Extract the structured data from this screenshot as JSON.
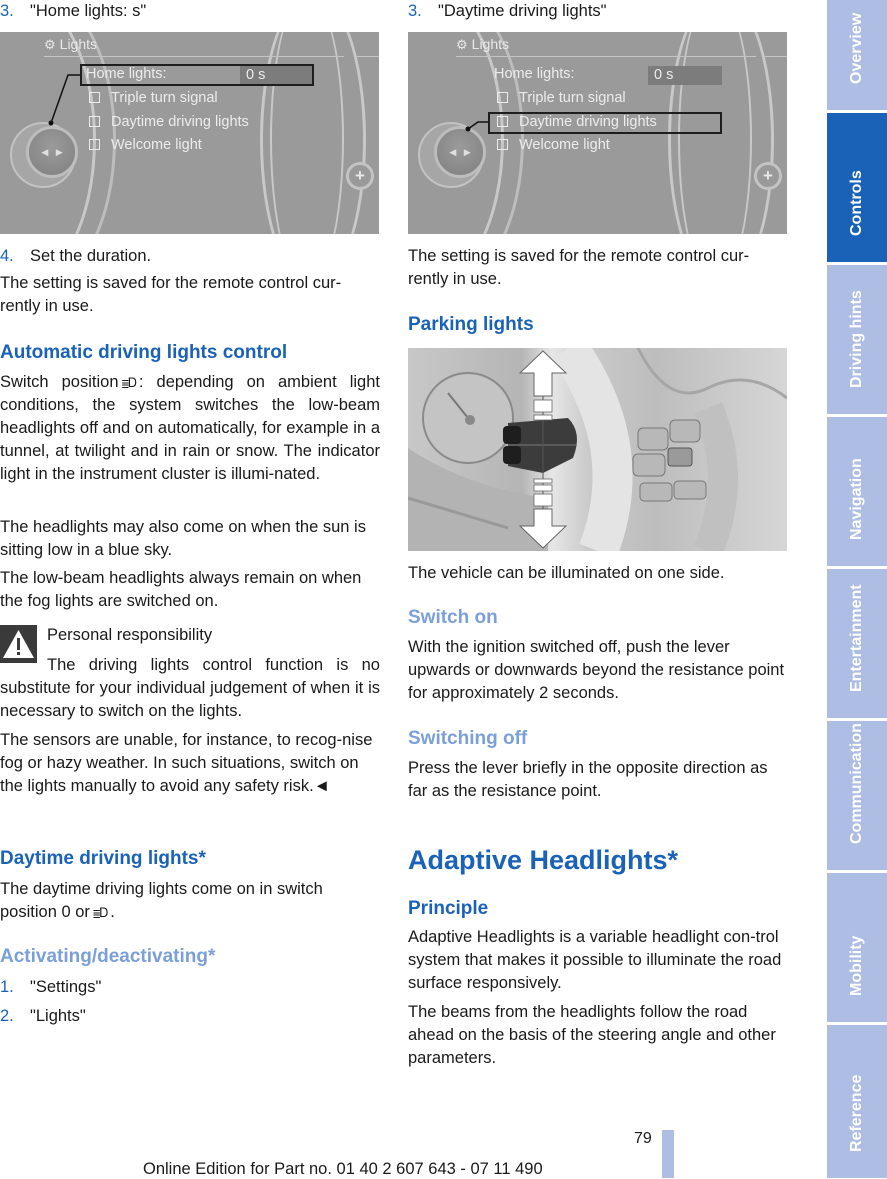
{
  "left_column": {
    "step3": {
      "num": "3.",
      "text": "\"Home lights: s\""
    },
    "screen1": {
      "title": "Lights",
      "home_lights_label": "Home lights:",
      "home_lights_value": "0 s",
      "items": [
        "Triple turn signal",
        "Daytime driving lights",
        "Welcome light"
      ],
      "highlighted": "Home lights:"
    },
    "step4": {
      "num": "4.",
      "text": "Set the duration."
    },
    "saved_note": "The setting is saved for the remote control cur-rently in use.",
    "auto_heading": "Automatic driving lights control",
    "auto_p1_a": "Switch position",
    "auto_p1_b": ": depending on ambient light conditions, the system switches the low-beam headlights off and on automatically, for example in a tunnel, at twilight and in rain or snow. The indicator light in the instrument cluster is illumi-nated.",
    "auto_p2": "The headlights may also come on when the sun is sitting low in a blue sky.",
    "auto_p3": "The low-beam headlights always remain on when the fog lights are switched on.",
    "warning": {
      "title": "Personal responsibility",
      "p1": "The driving lights control function is no substitute for your individual judgement of when it is necessary to switch on the lights.",
      "p2": "The sensors are unable, for instance, to recog-nise fog or hazy weather. In such situations, switch on the lights manually to avoid any safety risk.◄"
    },
    "daytime_heading": "Daytime driving lights*",
    "daytime_p_a": "The daytime driving lights come on in switch position 0 or",
    "daytime_p_b": ".",
    "activating_heading": "Activating/deactivating*",
    "steps": [
      {
        "num": "1.",
        "text": "\"Settings\""
      },
      {
        "num": "2.",
        "text": "\"Lights\""
      }
    ],
    "switch_icon": "auto-headlight-icon"
  },
  "right_column": {
    "step3": {
      "num": "3.",
      "text": "\"Daytime driving lights\""
    },
    "screen2": {
      "title": "Lights",
      "home_lights_label": "Home lights:",
      "home_lights_value": "0 s",
      "items": [
        "Triple turn signal",
        "Daytime driving lights",
        "Welcome light"
      ],
      "highlighted": "Daytime driving lights"
    },
    "saved_note": "The setting is saved for the remote control cur-rently in use.",
    "parking_heading": "Parking lights",
    "parking_caption": "The vehicle can be illuminated on one side.",
    "switch_on_heading": "Switch on",
    "switch_on_text": "With the ignition switched off, push the lever upwards or downwards beyond the resistance point for approximately 2 seconds.",
    "switching_off_heading": "Switching off",
    "switching_off_text": "Press the lever briefly in the opposite direction as far as the resistance point.",
    "adaptive_heading": "Adaptive Headlights*",
    "principle_heading": "Principle",
    "principle_p1": "Adaptive Headlights is a variable headlight con-trol system that makes it possible to illuminate the road surface responsively.",
    "principle_p2": "The beams from the headlights follow the road ahead on the basis of the steering angle and other parameters."
  },
  "side_tabs": [
    {
      "label": "Overview",
      "active": false
    },
    {
      "label": "Controls",
      "active": true
    },
    {
      "label": "Driving hints",
      "active": false
    },
    {
      "label": "Navigation",
      "active": false
    },
    {
      "label": "Entertainment",
      "active": false
    },
    {
      "label": "Communication",
      "active": false
    },
    {
      "label": "Mobility",
      "active": false
    },
    {
      "label": "Reference",
      "active": false
    }
  ],
  "footer": {
    "page_number": "79",
    "edition": "Online Edition for Part no. 01 40 2 607 643 - 07 11 490"
  },
  "colors": {
    "heading_blue": "#1a62b8",
    "subheading_light_blue": "#7b9fd8",
    "tab_inactive": "#aebde3",
    "tab_active": "#1a62b8"
  }
}
